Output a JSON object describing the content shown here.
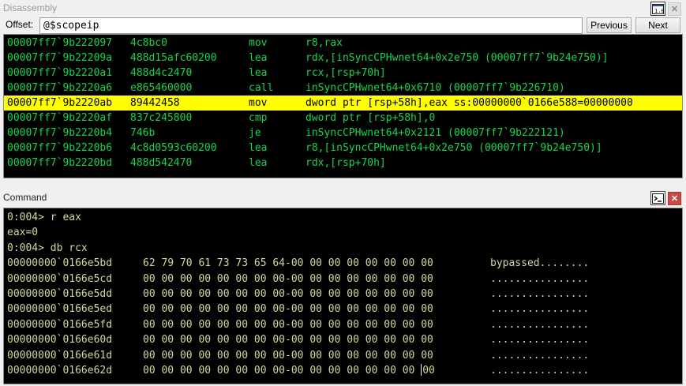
{
  "disassembly": {
    "title": "Disassembly",
    "offset_label": "Offset:",
    "offset_value": "@$scopeip",
    "prev_label": "Previous",
    "next_label": "Next",
    "lines": [
      {
        "addr": "00007ff7`9b222097",
        "bytes": "4c8bc0",
        "mnemonic": "mov",
        "operands": "r8,rax",
        "highlight": false
      },
      {
        "addr": "00007ff7`9b22209a",
        "bytes": "488d15afc60200",
        "mnemonic": "lea",
        "operands": "rdx,[inSyncCPHwnet64+0x2e750 (00007ff7`9b24e750)]",
        "highlight": false
      },
      {
        "addr": "00007ff7`9b2220a1",
        "bytes": "488d4c2470",
        "mnemonic": "lea",
        "operands": "rcx,[rsp+70h]",
        "highlight": false
      },
      {
        "addr": "00007ff7`9b2220a6",
        "bytes": "e865460000",
        "mnemonic": "call",
        "operands": "inSyncCPHwnet64+0x6710 (00007ff7`9b226710)",
        "highlight": false
      },
      {
        "addr": "00007ff7`9b2220ab",
        "bytes": "89442458",
        "mnemonic": "mov",
        "operands": "dword ptr [rsp+58h],eax ss:00000000`0166e588=00000000",
        "highlight": true
      },
      {
        "addr": "00007ff7`9b2220af",
        "bytes": "837c245800",
        "mnemonic": "cmp",
        "operands": "dword ptr [rsp+58h],0",
        "highlight": false
      },
      {
        "addr": "00007ff7`9b2220b4",
        "bytes": "746b",
        "mnemonic": "je",
        "operands": "inSyncCPHwnet64+0x2121 (00007ff7`9b222121)",
        "highlight": false
      },
      {
        "addr": "00007ff7`9b2220b6",
        "bytes": "4c8d0593c60200",
        "mnemonic": "lea",
        "operands": "r8,[inSyncCPHwnet64+0x2e750 (00007ff7`9b24e750)]",
        "highlight": false
      },
      {
        "addr": "00007ff7`9b2220bd",
        "bytes": "488d542470",
        "mnemonic": "lea",
        "operands": "rdx,[rsp+70h]",
        "highlight": false
      }
    ]
  },
  "command": {
    "title": "Command",
    "text_lines": [
      "0:004> r eax",
      "eax=0",
      "0:004> db rcx"
    ],
    "memory_rows": [
      {
        "addr": "00000000`0166e5bd",
        "hex": "62 79 70 61 73 73 65 64-00 00 00 00 00 00 00 00",
        "ascii": "bypassed........"
      },
      {
        "addr": "00000000`0166e5cd",
        "hex": "00 00 00 00 00 00 00 00-00 00 00 00 00 00 00 00",
        "ascii": "................"
      },
      {
        "addr": "00000000`0166e5dd",
        "hex": "00 00 00 00 00 00 00 00-00 00 00 00 00 00 00 00",
        "ascii": "................"
      },
      {
        "addr": "00000000`0166e5ed",
        "hex": "00 00 00 00 00 00 00 00-00 00 00 00 00 00 00 00",
        "ascii": "................"
      },
      {
        "addr": "00000000`0166e5fd",
        "hex": "00 00 00 00 00 00 00 00-00 00 00 00 00 00 00 00",
        "ascii": "................"
      },
      {
        "addr": "00000000`0166e60d",
        "hex": "00 00 00 00 00 00 00 00-00 00 00 00 00 00 00 00",
        "ascii": "................"
      },
      {
        "addr": "00000000`0166e61d",
        "hex": "00 00 00 00 00 00 00 00-00 00 00 00 00 00 00 00",
        "ascii": "................"
      },
      {
        "addr": "00000000`0166e62d",
        "hex_before_cursor": "00 00 00 00 00 00 00 00-00 00 00 00 00 00 00 ",
        "hex_after_cursor": "00",
        "ascii": "................"
      }
    ]
  },
  "icons": {
    "disasm_window": "source-window-icon",
    "shell": "command-prompt-icon",
    "close": "close-icon"
  },
  "colors": {
    "console_bg": "#000000",
    "disasm_text": "#17d44e",
    "command_text": "#d6d6a0",
    "highlight": "#ffff00",
    "close_button": "#c94a42"
  }
}
